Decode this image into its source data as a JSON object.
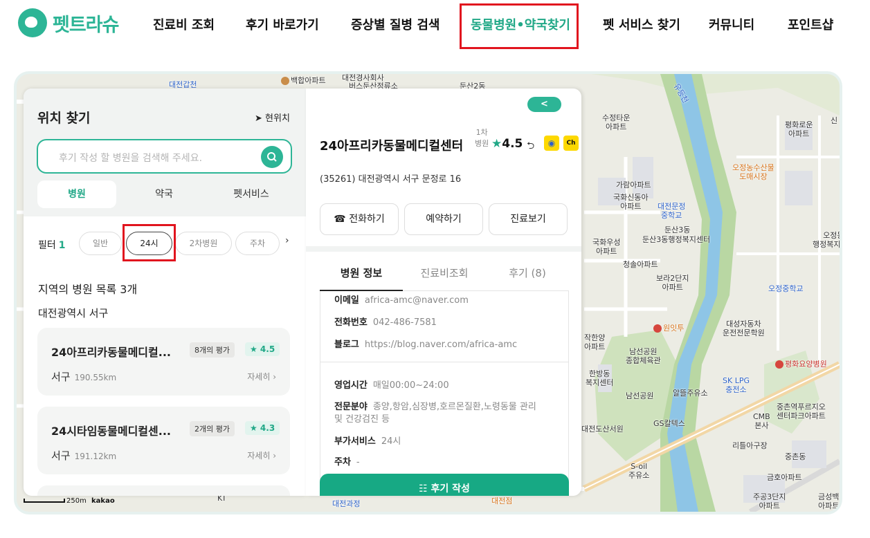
{
  "header": {
    "logo_text": "펫트라슈",
    "nav": [
      {
        "label": "진료비 조회"
      },
      {
        "label": "후기 바로가기"
      },
      {
        "label": "증상별 질병 검색"
      },
      {
        "label": "동물병원•약국찾기"
      },
      {
        "label": "펫 서비스 찾기"
      },
      {
        "label": "커뮤니티"
      },
      {
        "label": "포인트샵"
      }
    ]
  },
  "left_panel": {
    "title": "위치 찾기",
    "current_location": "현위치",
    "search_placeholder": "후기 작성 할 병원을 검색해 주세요.",
    "tabs": [
      "병원",
      "약국",
      "펫서비스"
    ],
    "filter_label": "필터",
    "filter_count": "1",
    "filter_chips": [
      "일반",
      "24시",
      "2차병원",
      "주차"
    ],
    "list_count": "지역의 병원 목록 3개",
    "region": "대전광역시 서구",
    "hospitals": [
      {
        "name": "24아프리카동물메디컬...",
        "reviews": "8개의 평가",
        "rating": "★ 4.5",
        "district": "서구",
        "distance": "190.55km",
        "more": "자세히 ›"
      },
      {
        "name": "24시타임동물메디컬센...",
        "reviews": "2개의 평가",
        "rating": "★ 4.3",
        "district": "서구",
        "distance": "191.12km",
        "more": "자세히 ›"
      }
    ]
  },
  "detail_panel": {
    "collapse": "<",
    "name": "24아프리카동물메디컬센터",
    "tier_line1": "1차",
    "tier_line2": "병원",
    "rating_star": "★",
    "rating": "4.5",
    "talk_icon_text": "Ch",
    "address": "(35261) 대전광역시 서구 문정로 16",
    "actions": [
      "전화하기",
      "예약하기",
      "진료보기"
    ],
    "tabs": [
      "병원 정보",
      "진료비조회",
      "후기 (8)"
    ],
    "info_top": [
      {
        "key": "이메일",
        "value": "africa-amc@naver.com"
      },
      {
        "key": "전화번호",
        "value": "042-486-7581"
      },
      {
        "key": "블로그",
        "value": "https://blog.naver.com/africa-amc"
      }
    ],
    "info_bottom": [
      {
        "key": "영업시간",
        "value": "매일00:00~24:00"
      },
      {
        "key": "전문분야",
        "value": "종양,항암,심장병,호르몬질환,노령동물 관리"
      },
      {
        "key": "",
        "value": "및 건강검진 등"
      },
      {
        "key": "부가서비스",
        "value": "24시"
      },
      {
        "key": "주차",
        "value": "-"
      }
    ],
    "review_button": "후기 작성"
  },
  "map": {
    "scale_label": "250m",
    "provider": "kakao",
    "labels": [
      "대전갑천",
      "백합아파트",
      "대전경사회사",
      "버스둔산정류소",
      "둔산2동",
      "수정타운",
      "아파트",
      "평화로운",
      "아파트",
      "오정농수산물",
      "도매시장",
      "가람아파트",
      "국화신동아",
      "아파트",
      "대전문정",
      "중학교",
      "둔산3동",
      "둔산3동행정복지센터",
      "국화우성",
      "아파트",
      "청솔아파트",
      "보라2단지",
      "아파트",
      "오정동",
      "행정복지센터",
      "오정중학교",
      "원잇투",
      "대성자동차",
      "운전전문학원",
      "작한양",
      "아파트",
      "남선공원",
      "종합체육관",
      "남선공원",
      "알뜰주유소",
      "SK LPG",
      "충전소",
      "평화요양병원",
      "중촌역푸르지오",
      "센터파크아파트",
      "CMB",
      "본사",
      "대전도산서원",
      "GS칼텍스",
      "리틀아구장",
      "S-oil",
      "주유소",
      "중촌동",
      "금호아파트",
      "주공3단지",
      "아파트",
      "금성백",
      "아파트",
      "KT",
      "대전과정",
      "대전점",
      "유등천",
      "한방동",
      "복지센터",
      "신"
    ]
  },
  "colors": {
    "brand": "#2db596",
    "highlight": "#e1141e",
    "review_button": "#17a984"
  }
}
